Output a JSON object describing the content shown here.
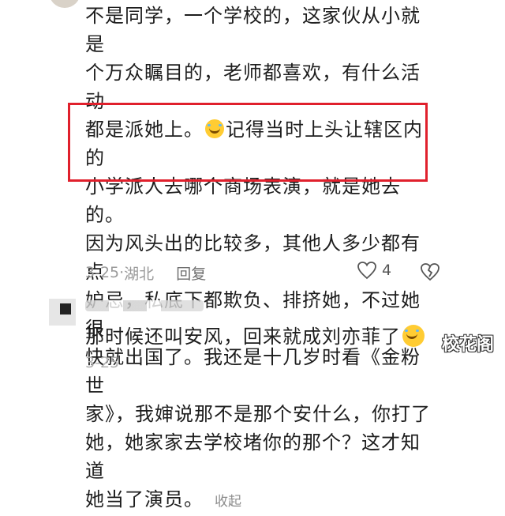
{
  "comment": {
    "lines_before_emoji": "不是同学，一个学校的，这家伙从小就是\n个万众瞩目的，老师都喜欢，有什么活动\n都是派她上。",
    "lines_after_emoji": "记得当时上头让辖区内的\n小学派人去哪个商场表演，就是她去的。\n因为风头出的比较多，其他人多少都有点\n妒忌，私底下都欺负、排挤她，不过她很\n快就出国了。我还是十几岁时看《金粉世\n家》，我婶说那不是那个安什么，你打了\n她，她家家去学校堵你的那个？这才知道\n她当了演员。",
    "collapse_label": "收起",
    "date": "3-25",
    "location": "湖北",
    "reply_label": "回复",
    "like_count": "4"
  },
  "reply_comment": {
    "text": "那时候还叫安风，回来就成刘亦菲了",
    "meta": "3-25"
  },
  "icons": {
    "emoji_inline": "laughing-tears-emoji",
    "emoji_reply": "laughing-tears-emoji",
    "like": "heart-icon",
    "dislike": "broken-heart-icon"
  },
  "watermark": "校花阁",
  "colors": {
    "highlight": "#e0202c",
    "text": "#1d1d1d",
    "meta": "#9a9a9a"
  }
}
